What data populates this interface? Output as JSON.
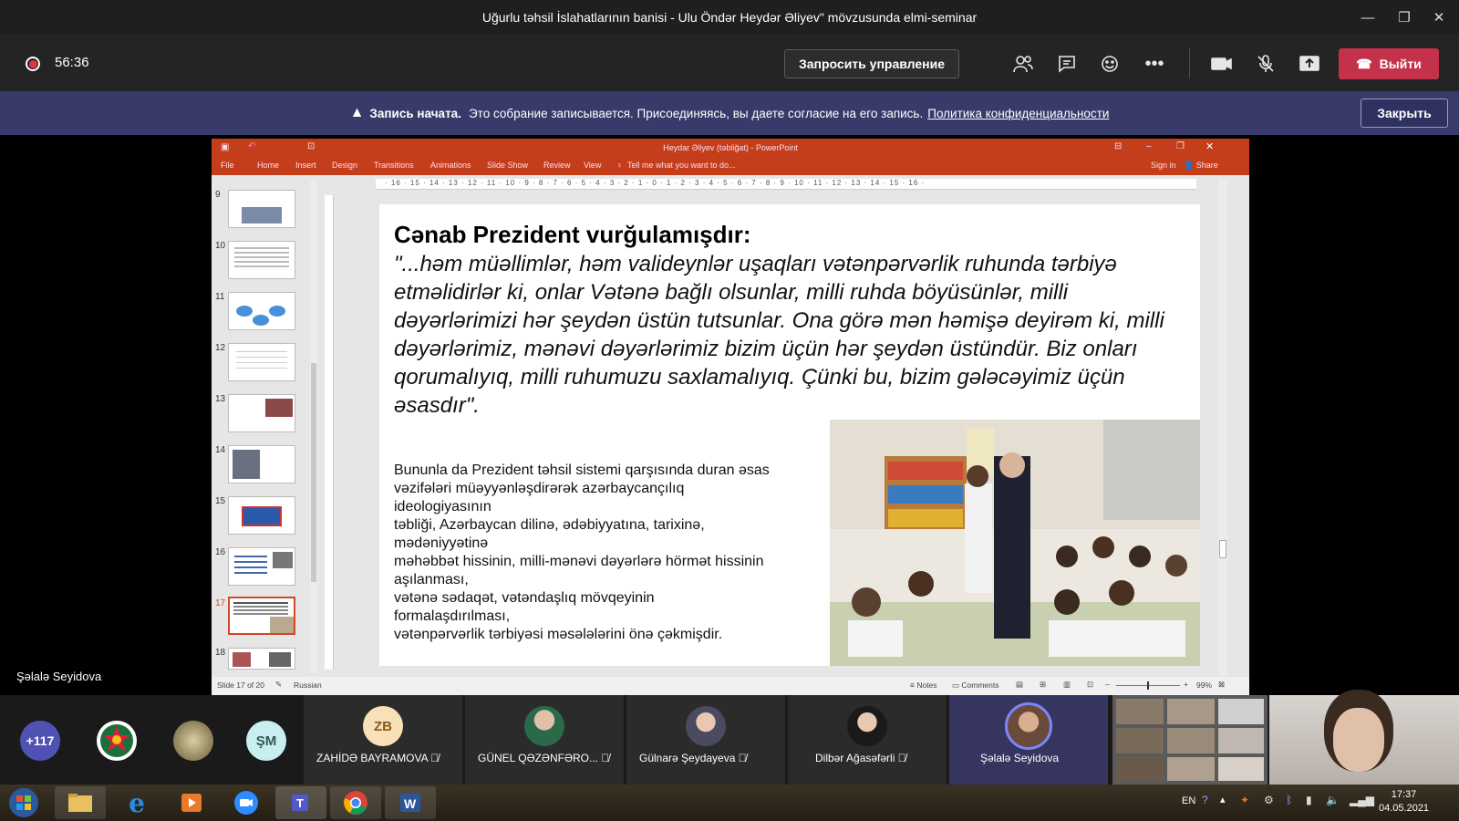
{
  "window": {
    "title": "Uğurlu təhsil İslahatlarının banisi - Ulu Öndər Heydər Əliyev\" mövzusunda elmi-seminar"
  },
  "meeting": {
    "timer": "56:36",
    "request_control": "Запросить управление",
    "leave": "Выйти"
  },
  "banner": {
    "bold": "Запись начата.",
    "text": "Это собрание записывается. Присоединяясь, вы даете согласие на его запись.",
    "link": "Политика конфиденциальности",
    "close": "Закрыть"
  },
  "ppt": {
    "title": "Heydar Əliyev (təbliğat) - PowerPoint",
    "menu": [
      "File",
      "Home",
      "Insert",
      "Design",
      "Transitions",
      "Animations",
      "Slide Show",
      "Review",
      "View"
    ],
    "tell_me": "Tell me what you want to do...",
    "sign_in": "Sign in",
    "share": "Share",
    "ruler": "· 16 · 15 · 14 · 13 · 12 · 11 · 10 · 9 · 8 · 7 · 6 · 5 · 4 · 3 · 2 · 1 · 0 · 1 · 2 · 3 · 4 · 5 · 6 · 7 · 8 · 9 · 10 · 11 · 12 · 13 · 14 · 15 · 16 ·",
    "thumbnails": [
      "9",
      "10",
      "11",
      "12",
      "13",
      "14",
      "15",
      "16",
      "17",
      "18"
    ],
    "status": {
      "slide": "Slide 17 of 20",
      "language": "Russian",
      "notes": "Notes",
      "comments": "Comments",
      "zoom": "99%"
    }
  },
  "slide": {
    "heading": "Cənab Prezident vurğulamışdır:",
    "quote": "\"...həm müəllimlər, həm valideynlər uşaqları vətənpərvərlik ruhunda tərbiyə etməlidirlər ki, onlar Vətənə bağlı olsunlar, milli ruhda böyüsünlər, milli dəyərlərimizi hər şeydən üstün tutsunlar. Ona görə mən həmişə deyirəm ki, milli dəyərlərimiz, mənəvi dəyərlərimiz bizim üçün hər şeydən üstündür. Biz onları qorumalıyıq, milli ruhumuzu saxlamalıyıq. Çünki bu, bizim gələcəyimiz üçün əsasdır\".",
    "body": "Bununla da Prezident təhsil sistemi qarşısında duran əsas\nvəzifələri müəyyənləşdirərək azərbaycançılıq\nideologiyasının\ntəbliği, Azərbaycan dilinə, ədəbiyyatına, tarixinə,\nmədəniyyətinə\nməhəbbət hissinin, milli-mənəvi dəyərlərə hörmət hissinin\naşılanması,\nvətənə sədaqət, vətəndaşlıq mövqeyinin\nformalaşdırılması,\nvətənpərvərlik tərbiyəsi məsələlərini önə çəkmişdir."
  },
  "presenter": {
    "name": "Şəlalə Seyidova"
  },
  "participants": {
    "count": "+117",
    "sm": "ŞM",
    "tiles": [
      {
        "initials": "ZB",
        "name": "ZAHİDƏ BAYRAMOVA"
      },
      {
        "initials": "",
        "name": "GÜNEL QƏZƏNFƏRO..."
      },
      {
        "initials": "",
        "name": "Gülnarə Şeydayeva"
      },
      {
        "initials": "",
        "name": "Dilbər Ağasəfərli"
      },
      {
        "initials": "",
        "name": "Şəlalə Seyidova"
      }
    ]
  },
  "taskbar": {
    "lang": "EN",
    "time": "17:37",
    "date": "04.05.2021"
  },
  "colors": {
    "accent": "#c4314b",
    "banner": "#383a6a",
    "ppt": "#c43e1c"
  }
}
